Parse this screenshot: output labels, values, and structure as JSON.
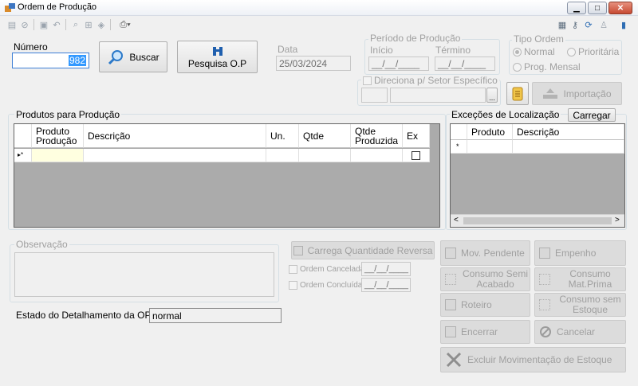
{
  "window": {
    "title": "Ordem de Produção",
    "minimize_glyph": "▁",
    "maximize_glyph": "□",
    "close_glyph": "✕"
  },
  "toolbar": {
    "icons": [
      "new-icon",
      "cancel-icon",
      "save-icon",
      "undo-icon",
      "search-icon",
      "grid-icon",
      "eraser-icon",
      "print-icon"
    ],
    "right_icons": [
      "calculator-icon",
      "key-icon",
      "refresh-icon",
      "user-icon",
      "exit-icon"
    ]
  },
  "numero": {
    "label": "Número",
    "value": "982"
  },
  "buscar_button": "Buscar",
  "pesquisa_button": "Pesquisa O.P",
  "data": {
    "label": "Data",
    "value": "25/03/2024"
  },
  "periodo": {
    "title": "Período de Produção",
    "inicio_label": "Início",
    "termino_label": "Término",
    "inicio_value": "__/__/____",
    "termino_value": "__/__/____"
  },
  "tipo_ordem": {
    "title": "Tipo Ordem",
    "options": [
      "Normal",
      "Prioritária",
      "Prog. Mensal"
    ],
    "selected": "Normal"
  },
  "direciona": {
    "label": "Direciona p/ Setor Específico",
    "ellipsis": "..."
  },
  "importacao_button": "Importação",
  "produtos": {
    "title": "Produtos para Produção",
    "columns": [
      "Produto Produção",
      "Descrição",
      "Un.",
      "Qtde",
      "Qtde Produzida",
      "Ex"
    ],
    "row_marker": "▸*"
  },
  "excecoes": {
    "title": "Exceções de Localização",
    "carregar_button": "Carregar",
    "columns": [
      "Produto",
      "Descrição"
    ],
    "row_marker": "*",
    "scroll_left": "<",
    "scroll_right": ">"
  },
  "observacao": {
    "title": "Observação"
  },
  "estado": {
    "label": "Estado do Detalhamento da OP:",
    "value": "normal"
  },
  "carrega_reversa_button": "Carrega Quantidade Reversa",
  "ordem_cancelada": {
    "label": "Ordem Cancelada",
    "value": "__/__/____"
  },
  "ordem_concluida": {
    "label": "Ordem Concluída",
    "value": "__/__/____"
  },
  "actions": {
    "mov_pendente": "Mov. Pendente",
    "empenho": "Empenho",
    "consumo_semi": "Consumo Semi Acabado",
    "consumo_mat": "Consumo Mat.Prima",
    "roteiro": "Roteiro",
    "consumo_sem_estoque": "Consumo sem Estoque",
    "encerrar": "Encerrar",
    "cancelar": "Cancelar",
    "excluir_mov": "Excluir Movimentação de Estoque"
  }
}
